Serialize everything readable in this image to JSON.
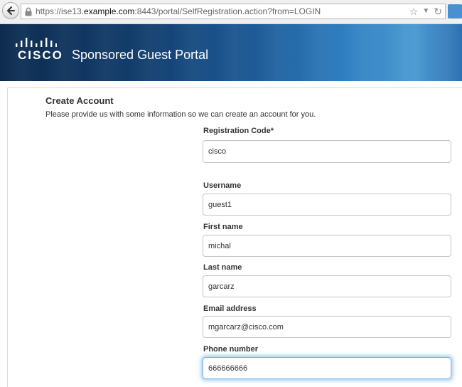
{
  "browser": {
    "url_prefix": "https://ise13.",
    "url_domain": "example.com",
    "url_suffix": ":8443/portal/SelfRegistration.action?from=LOGIN",
    "icons": [
      "back-arrow-icon",
      "lock-icon",
      "star-icon",
      "dropdown-icon",
      "refresh-icon"
    ]
  },
  "header": {
    "logo_text": "CISCO",
    "title": "Sponsored Guest Portal"
  },
  "form": {
    "heading": "Create Account",
    "description": "Please provide us with some information so we can create an account for you.",
    "fields": [
      {
        "label": "Registration Code*",
        "value": "cisco"
      },
      {
        "label": "Username",
        "value": "guest1"
      },
      {
        "label": "First name",
        "value": "michal"
      },
      {
        "label": "Last name",
        "value": "garcarz"
      },
      {
        "label": "Email address",
        "value": "mgarcarz@cisco.com"
      },
      {
        "label": "Phone number",
        "value": "666666666"
      }
    ]
  }
}
